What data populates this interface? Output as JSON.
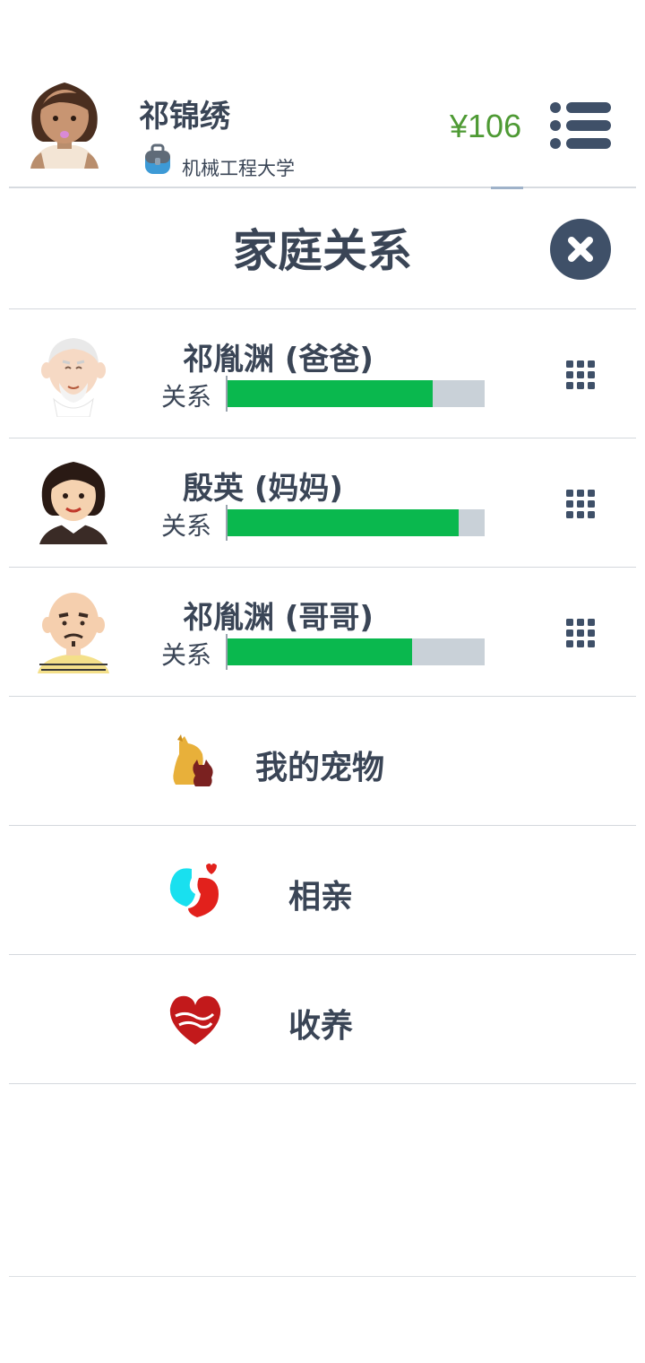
{
  "header": {
    "user_name": "祁锦绣",
    "school": "机械工程大学",
    "money": "¥106"
  },
  "section": {
    "title": "家庭关系"
  },
  "family": [
    {
      "name": "祁胤渊 (爸爸)",
      "relation_label": "关系",
      "relation_level": 0.8,
      "avatar": "old-man-avatar"
    },
    {
      "name": "殷英 (妈妈)",
      "relation_label": "关系",
      "relation_level": 0.9,
      "avatar": "woman-avatar"
    },
    {
      "name": "祁胤渊 (哥哥)",
      "relation_label": "关系",
      "relation_level": 0.72,
      "avatar": "bald-man-avatar"
    }
  ],
  "actions": [
    {
      "label": "我的宠物",
      "icon": "pet-dog-cat-icon"
    },
    {
      "label": "相亲",
      "icon": "couple-hearts-icon"
    },
    {
      "label": "收养",
      "icon": "hug-heart-icon"
    }
  ],
  "colors": {
    "money": "#4e9a34",
    "bar_fill": "#0ab84e",
    "bar_track": "#c9d1d8",
    "text": "#3a4556",
    "button_dark": "#3f5068"
  }
}
